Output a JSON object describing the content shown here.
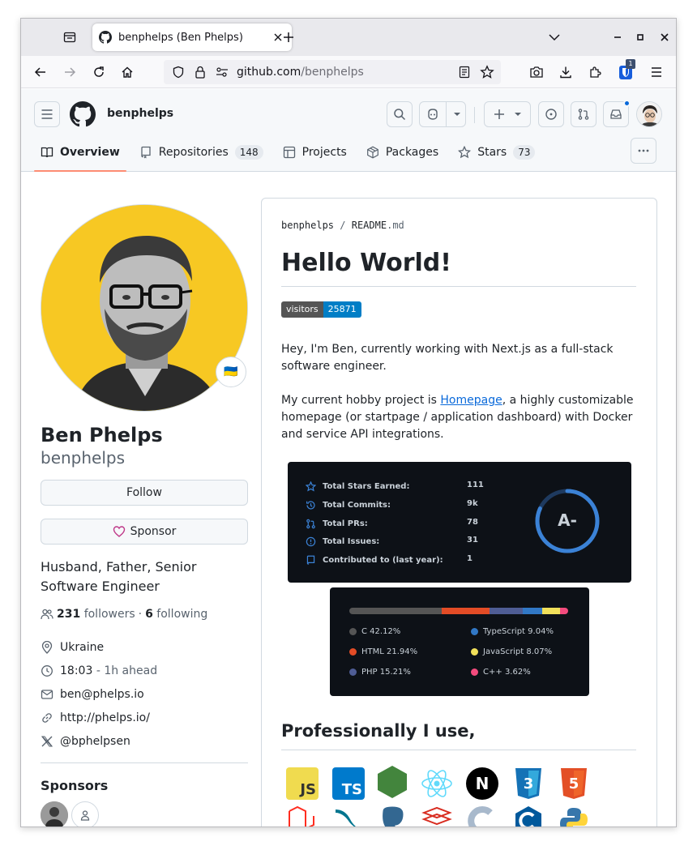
{
  "browser": {
    "tab_title": "benphelps (Ben Phelps)",
    "url_host": "github.com",
    "url_path": "/benphelps",
    "extension_badge": "1"
  },
  "header": {
    "username": "benphelps",
    "nav": {
      "overview": "Overview",
      "repositories": "Repositories",
      "repositories_count": "148",
      "projects": "Projects",
      "packages": "Packages",
      "stars": "Stars",
      "stars_count": "73"
    }
  },
  "profile": {
    "name": "Ben Phelps",
    "login": "benphelps",
    "follow_label": "Follow",
    "sponsor_label": "Sponsor",
    "bio": "Husband, Father, Senior Software Engineer",
    "followers_count": "231",
    "followers_label": "followers",
    "separator": "·",
    "following_count": "6",
    "following_label": "following",
    "location": "Ukraine",
    "local_time": "18:03",
    "time_offset": "- 1h ahead",
    "email": "ben@phelps.io",
    "website": "http://phelps.io/",
    "twitter": "@bphelpsen",
    "sponsors_heading": "Sponsors",
    "flag_emoji": "🇺🇦"
  },
  "readme": {
    "path_owner": "benphelps",
    "path_sep": "/",
    "path_file": "README",
    "path_ext": ".md",
    "heading": "Hello World!",
    "badge_label": "visitors",
    "badge_value": "25871",
    "intro": "Hey, I'm Ben, currently working with Next.js as a full-stack software engineer.",
    "hobby_prefix": "My current hobby project is ",
    "hobby_link": "Homepage",
    "hobby_suffix": ", a highly customizable homepage (or startpage / application dashboard) with Docker and service API integrations.",
    "professional_heading": "Professionally I use,"
  },
  "stats_card": {
    "rows": [
      {
        "label": "Total Stars Earned:",
        "value": "111"
      },
      {
        "label": "Total Commits:",
        "value": "9k"
      },
      {
        "label": "Total PRs:",
        "value": "78"
      },
      {
        "label": "Total Issues:",
        "value": "31"
      },
      {
        "label": "Contributed to (last year):",
        "value": "1"
      }
    ],
    "rank": "A-",
    "accent": "#3b82d6"
  },
  "languages": [
    {
      "name": "C",
      "percent": "42.12%",
      "value": 42.12,
      "color": "#555555"
    },
    {
      "name": "HTML",
      "percent": "21.94%",
      "value": 21.94,
      "color": "#e34c26"
    },
    {
      "name": "PHP",
      "percent": "15.21%",
      "value": 15.21,
      "color": "#4F5D95"
    },
    {
      "name": "TypeScript",
      "percent": "9.04%",
      "value": 9.04,
      "color": "#3178c6"
    },
    {
      "name": "JavaScript",
      "percent": "8.07%",
      "value": 8.07,
      "color": "#f1e05a"
    },
    {
      "name": "C++",
      "percent": "3.62%",
      "value": 3.62,
      "color": "#f34b7d"
    }
  ],
  "skills": [
    {
      "name": "javascript",
      "text": "JS"
    },
    {
      "name": "typescript",
      "text": "TS"
    },
    {
      "name": "nodejs",
      "text": ""
    },
    {
      "name": "react",
      "text": ""
    },
    {
      "name": "nextjs",
      "text": "N"
    },
    {
      "name": "css3",
      "text": "3"
    },
    {
      "name": "html5",
      "text": "5"
    }
  ]
}
